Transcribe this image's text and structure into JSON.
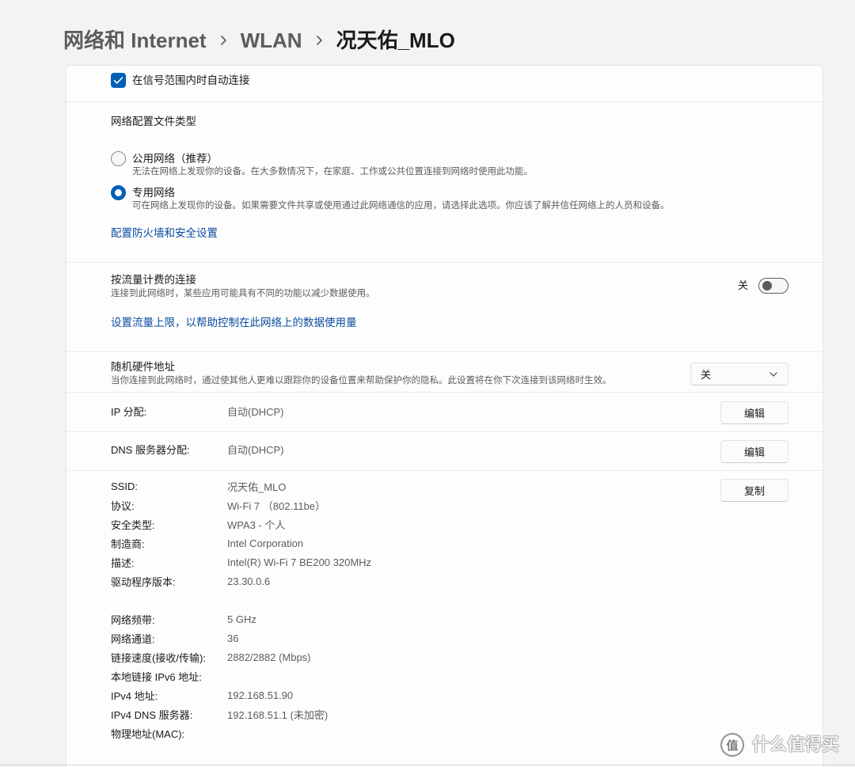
{
  "breadcrumb": {
    "items": [
      "网络和 Internet",
      "WLAN"
    ],
    "current": "况天佑_MLO"
  },
  "auto_connect": {
    "label": "在信号范围内时自动连接",
    "checked": true
  },
  "profile_type": {
    "heading": "网络配置文件类型",
    "options": [
      {
        "label": "公用网络（推荐）",
        "description": "无法在网络上发现你的设备。在大多数情况下，在家庭、工作或公共位置连接到网络时使用此功能。",
        "selected": false
      },
      {
        "label": "专用网络",
        "description": "可在网络上发现你的设备。如果需要文件共享或使用通过此网络通信的应用，请选择此选项。你应该了解并信任网络上的人员和设备。",
        "selected": true
      }
    ],
    "firewall_link": "配置防火墙和安全设置"
  },
  "metered": {
    "title": "按流量计费的连接",
    "description": "连接到此网络时，某些应用可能具有不同的功能以减少数据使用。",
    "toggle_label": "关",
    "toggle_on": false,
    "data_limit_link": "设置流量上限，以帮助控制在此网络上的数据使用量"
  },
  "random_hw": {
    "title": "随机硬件地址",
    "description": "当你连接到此网络时，通过使其他人更难以跟踪你的设备位置来帮助保护你的隐私。此设置将在你下次连接到该网络时生效。",
    "selected": "关"
  },
  "ip_assignment": {
    "label": "IP 分配:",
    "value": "自动(DHCP)",
    "button": "编辑"
  },
  "dns_assignment": {
    "label": "DNS 服务器分配:",
    "value": "自动(DHCP)",
    "button": "编辑"
  },
  "properties": {
    "copy_button": "复制",
    "group1": [
      {
        "label": "SSID:",
        "value": "况天佑_MLO"
      },
      {
        "label": "协议:",
        "value": "Wi-Fi 7 （802.11be）"
      },
      {
        "label": "安全类型:",
        "value": "WPA3 - 个人"
      },
      {
        "label": "制造商:",
        "value": "Intel Corporation"
      },
      {
        "label": "描述:",
        "value": "Intel(R) Wi-Fi 7 BE200 320MHz"
      },
      {
        "label": "驱动程序版本:",
        "value": "23.30.0.6"
      }
    ],
    "group2": [
      {
        "label": "网络频带:",
        "value": "5 GHz"
      },
      {
        "label": "网络通道:",
        "value": "36"
      },
      {
        "label": "链接速度(接收/传输):",
        "value": "2882/2882 (Mbps)"
      },
      {
        "label": "本地链接 IPv6 地址:",
        "value": ""
      },
      {
        "label": "IPv4 地址:",
        "value": "192.168.51.90"
      },
      {
        "label": "IPv4 DNS 服务器:",
        "value": "192.168.51.1 (未加密)"
      },
      {
        "label": "物理地址(MAC):",
        "value": ""
      }
    ]
  },
  "icons": {
    "breadcrumb_separator": "chevron-right-icon",
    "checkbox_mark": "checkmark-icon",
    "dropdown_arrow": "chevron-down-icon",
    "watermark": "watermark-logo-icon"
  },
  "colors": {
    "accent": "#005fb8",
    "link": "#0b4c9f",
    "background": "#f3f3f3"
  },
  "watermark": {
    "icon_char": "值",
    "text": "什么值得买"
  }
}
